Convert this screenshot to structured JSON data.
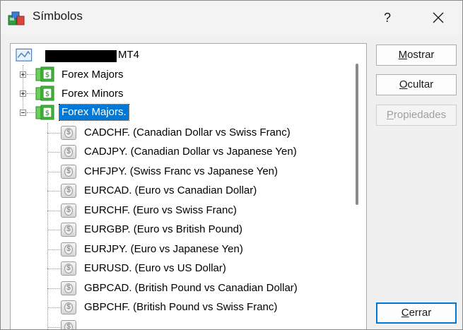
{
  "window": {
    "title": "Símbolos"
  },
  "titlebar": {
    "help_label": "?",
    "close_label": "✕"
  },
  "tree": {
    "root": {
      "label": "MT4"
    },
    "groups": [
      {
        "label": "Forex Majors",
        "state": "collapsed"
      },
      {
        "label": "Forex Minors",
        "state": "collapsed"
      },
      {
        "label": "Forex Majors.",
        "state": "expanded",
        "selected": true
      }
    ],
    "symbols": [
      "CADCHF.  (Canadian Dollar vs Swiss Franc)",
      "CADJPY.  (Canadian Dollar vs Japanese Yen)",
      "CHFJPY.  (Swiss Franc vs Japanese Yen)",
      "EURCAD.  (Euro vs Canadian Dollar)",
      "EURCHF.  (Euro vs Swiss Franc)",
      "EURGBP.  (Euro vs British Pound)",
      "EURJPY.  (Euro vs Japanese Yen)",
      "EURUSD.  (Euro vs US Dollar)",
      "GBPCAD.  (British Pound vs Canadian Dollar)",
      "GBPCHF.  (British Pound vs Swiss Franc)"
    ]
  },
  "buttons": {
    "show": {
      "mnemonic": "M",
      "rest": "ostrar"
    },
    "hide": {
      "mnemonic": "O",
      "rest": "cultar"
    },
    "properties": {
      "mnemonic": "P",
      "rest": "ropiedades"
    },
    "close": {
      "mnemonic": "C",
      "rest": "errar"
    }
  },
  "colors": {
    "selection": "#0078d7",
    "accent": "#0078d7"
  }
}
